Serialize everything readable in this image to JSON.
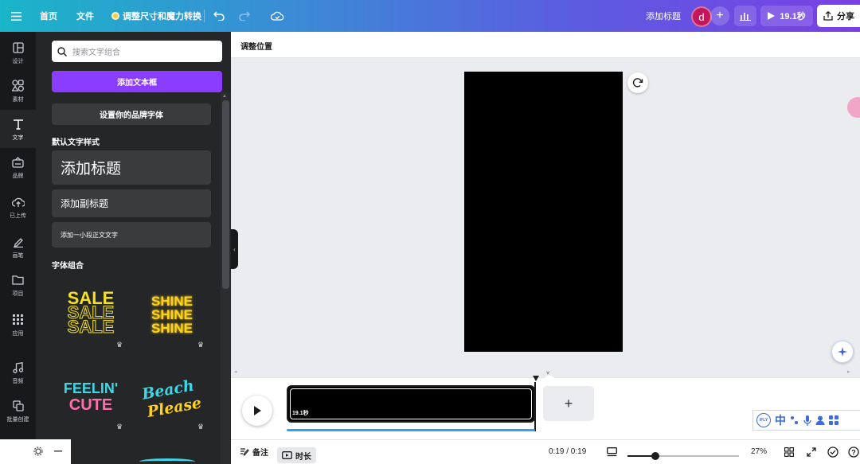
{
  "topbar": {
    "home": "首页",
    "file": "文件",
    "resize": "调整尺寸和魔力转换",
    "add_title": "添加标题",
    "avatar_letter": "d",
    "duration": "19.1秒",
    "share": "分享"
  },
  "rail": [
    {
      "label": "设计",
      "icon": "layout-icon"
    },
    {
      "label": "素材",
      "icon": "elements-icon"
    },
    {
      "label": "文字",
      "icon": "text-icon"
    },
    {
      "label": "品牌",
      "icon": "brand-icon"
    },
    {
      "label": "已上传",
      "icon": "upload-icon"
    },
    {
      "label": "画笔",
      "icon": "draw-icon"
    },
    {
      "label": "项目",
      "icon": "folder-icon"
    },
    {
      "label": "应用",
      "icon": "apps-icon"
    },
    {
      "label": "音频",
      "icon": "music-icon"
    },
    {
      "label": "批量创建",
      "icon": "bulk-create-icon"
    }
  ],
  "panel": {
    "search_placeholder": "搜索文字组合",
    "add_textbox": "添加文本框",
    "brand_fonts": "设置你的品牌字体",
    "default_styles": "默认文字样式",
    "heading": "添加标题",
    "subheading": "添加副标题",
    "body": "添加一小段正文文字",
    "combos": "字体组合",
    "combo_texts": {
      "sale": "SALE",
      "shine": "SHINE",
      "feelin": "FEELIN'",
      "cute": "CUTE",
      "beach": "Beach",
      "please": "Please"
    }
  },
  "canvas": {
    "subbar_label": "调整位置"
  },
  "timeline": {
    "clip_duration": "19.1秒",
    "playback_fraction": 1.0
  },
  "statusbar": {
    "notes": "备注",
    "duration": "时长",
    "time": "0:19 / 0:19",
    "zoom": "27%",
    "zoom_fraction": 0.25
  },
  "ime": {
    "lang": "中"
  },
  "colors": {
    "accent": "#8b3dff",
    "panel_bg": "#252627",
    "rail_bg": "#18191b",
    "progress": "#2fa4ea",
    "sale_yellow": "#f5e021",
    "shine_yellow": "#ffd21f",
    "feelin_cyan": "#3fd7e6",
    "cute_pink": "#ff6fae"
  }
}
